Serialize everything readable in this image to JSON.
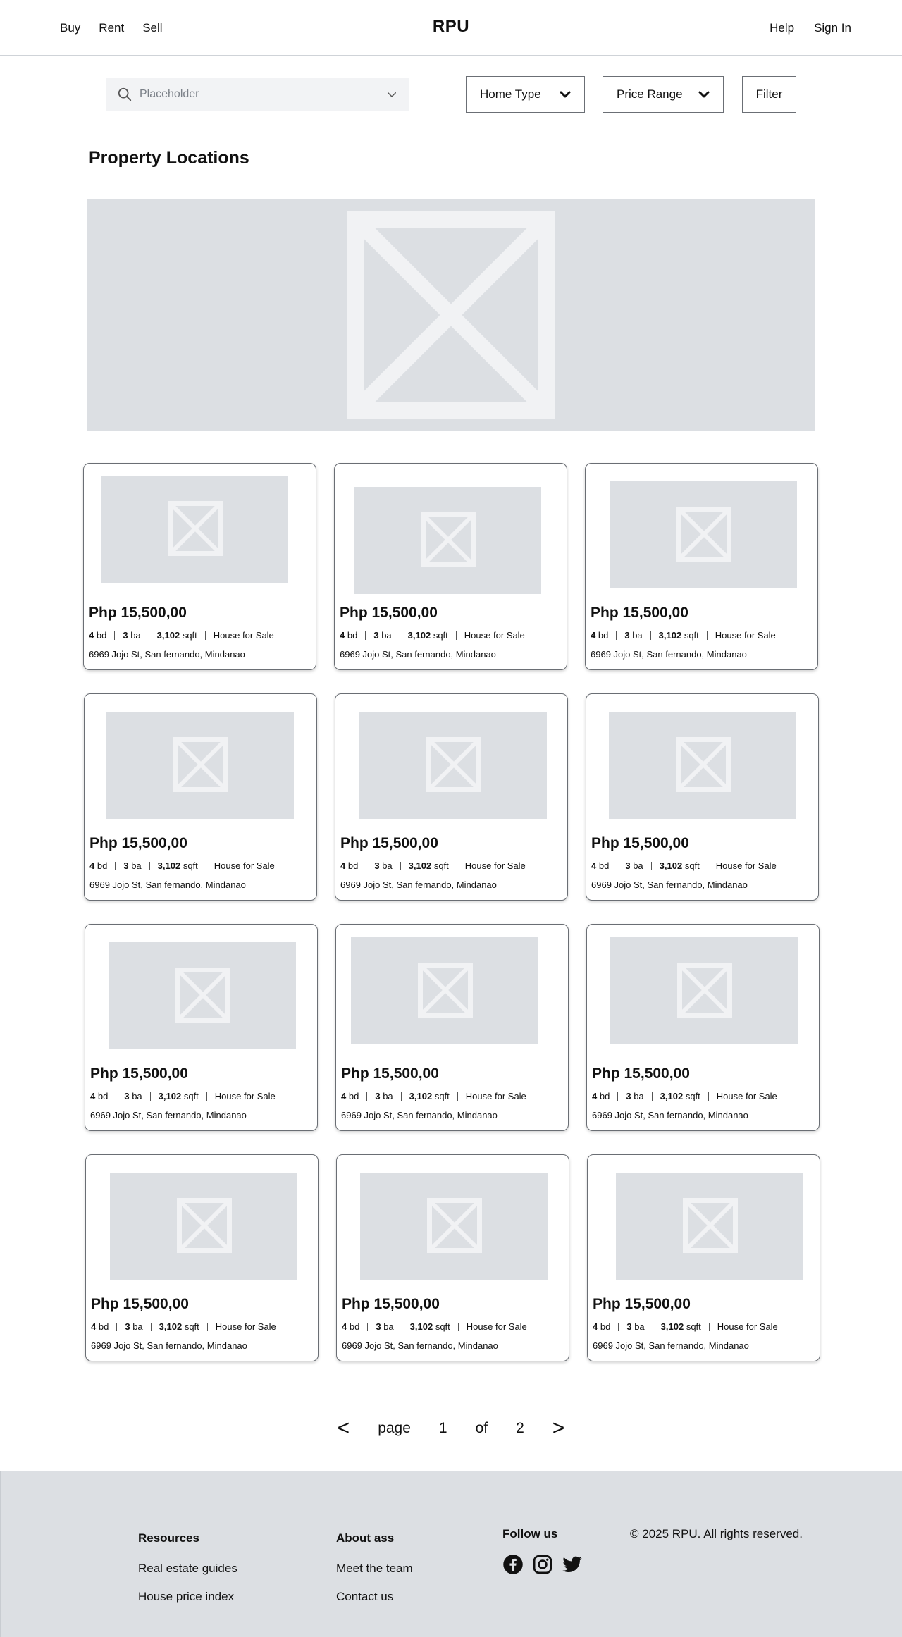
{
  "header": {
    "nav_left": [
      "Buy",
      "Rent",
      "Sell"
    ],
    "logo": "RPU",
    "nav_right": [
      "Help",
      "Sign In"
    ]
  },
  "filters": {
    "search_placeholder": "Placeholder",
    "home_type": "Home Type",
    "price_range": "Price Range",
    "filter": "Filter"
  },
  "section_title": "Property Locations",
  "listings": [
    {
      "price": "Php 15,500,00",
      "bd": "4",
      "bd_unit": "bd",
      "ba": "3",
      "ba_unit": "ba",
      "sqft": "3,102",
      "sqft_unit": "sqft",
      "type": "House for Sale",
      "address": "6969 Jojo St, San fernando, Mindanao"
    },
    {
      "price": "Php 15,500,00",
      "bd": "4",
      "bd_unit": "bd",
      "ba": "3",
      "ba_unit": "ba",
      "sqft": "3,102",
      "sqft_unit": "sqft",
      "type": "House for Sale",
      "address": "6969 Jojo St, San fernando, Mindanao"
    },
    {
      "price": "Php 15,500,00",
      "bd": "4",
      "bd_unit": "bd",
      "ba": "3",
      "ba_unit": "ba",
      "sqft": "3,102",
      "sqft_unit": "sqft",
      "type": "House for Sale",
      "address": "6969 Jojo St, San fernando, Mindanao"
    },
    {
      "price": "Php 15,500,00",
      "bd": "4",
      "bd_unit": "bd",
      "ba": "3",
      "ba_unit": "ba",
      "sqft": "3,102",
      "sqft_unit": "sqft",
      "type": "House for Sale",
      "address": "6969 Jojo St, San fernando, Mindanao"
    },
    {
      "price": "Php 15,500,00",
      "bd": "4",
      "bd_unit": "bd",
      "ba": "3",
      "ba_unit": "ba",
      "sqft": "3,102",
      "sqft_unit": "sqft",
      "type": "House for Sale",
      "address": "6969 Jojo St, San fernando, Mindanao"
    },
    {
      "price": "Php 15,500,00",
      "bd": "4",
      "bd_unit": "bd",
      "ba": "3",
      "ba_unit": "ba",
      "sqft": "3,102",
      "sqft_unit": "sqft",
      "type": "House for Sale",
      "address": "6969 Jojo St, San fernando, Mindanao"
    },
    {
      "price": "Php 15,500,00",
      "bd": "4",
      "bd_unit": "bd",
      "ba": "3",
      "ba_unit": "ba",
      "sqft": "3,102",
      "sqft_unit": "sqft",
      "type": "House for Sale",
      "address": "6969 Jojo St, San fernando, Mindanao"
    },
    {
      "price": "Php 15,500,00",
      "bd": "4",
      "bd_unit": "bd",
      "ba": "3",
      "ba_unit": "ba",
      "sqft": "3,102",
      "sqft_unit": "sqft",
      "type": "House for Sale",
      "address": "6969 Jojo St, San fernando, Mindanao"
    },
    {
      "price": "Php 15,500,00",
      "bd": "4",
      "bd_unit": "bd",
      "ba": "3",
      "ba_unit": "ba",
      "sqft": "3,102",
      "sqft_unit": "sqft",
      "type": "House for Sale",
      "address": "6969 Jojo St, San fernando, Mindanao"
    },
    {
      "price": "Php 15,500,00",
      "bd": "4",
      "bd_unit": "bd",
      "ba": "3",
      "ba_unit": "ba",
      "sqft": "3,102",
      "sqft_unit": "sqft",
      "type": "House for Sale",
      "address": "6969 Jojo St, San fernando, Mindanao"
    },
    {
      "price": "Php 15,500,00",
      "bd": "4",
      "bd_unit": "bd",
      "ba": "3",
      "ba_unit": "ba",
      "sqft": "3,102",
      "sqft_unit": "sqft",
      "type": "House for Sale",
      "address": "6969 Jojo St, San fernando, Mindanao"
    },
    {
      "price": "Php 15,500,00",
      "bd": "4",
      "bd_unit": "bd",
      "ba": "3",
      "ba_unit": "ba",
      "sqft": "3,102",
      "sqft_unit": "sqft",
      "type": "House for Sale",
      "address": "6969 Jojo St, San fernando, Mindanao"
    }
  ],
  "pagination": {
    "prev": "<",
    "page_label": "page",
    "current": "1",
    "of_label": "of",
    "total": "2",
    "next": ">"
  },
  "footer": {
    "resources_title": "Resources",
    "resources_links": [
      "Real estate guides",
      "House price index"
    ],
    "about_title": "About ass",
    "about_links": [
      "Meet the team",
      "Contact us"
    ],
    "follow_title": "Follow us",
    "socials": [
      "facebook-icon",
      "instagram-icon",
      "twitter-icon"
    ],
    "copyright": "© 2025 RPU. All rights reserved."
  },
  "colors": {
    "placeholder_bg": "#dcdfe3",
    "placeholder_mark": "#f1f2f4",
    "footer_bg": "#dcdfe3"
  }
}
